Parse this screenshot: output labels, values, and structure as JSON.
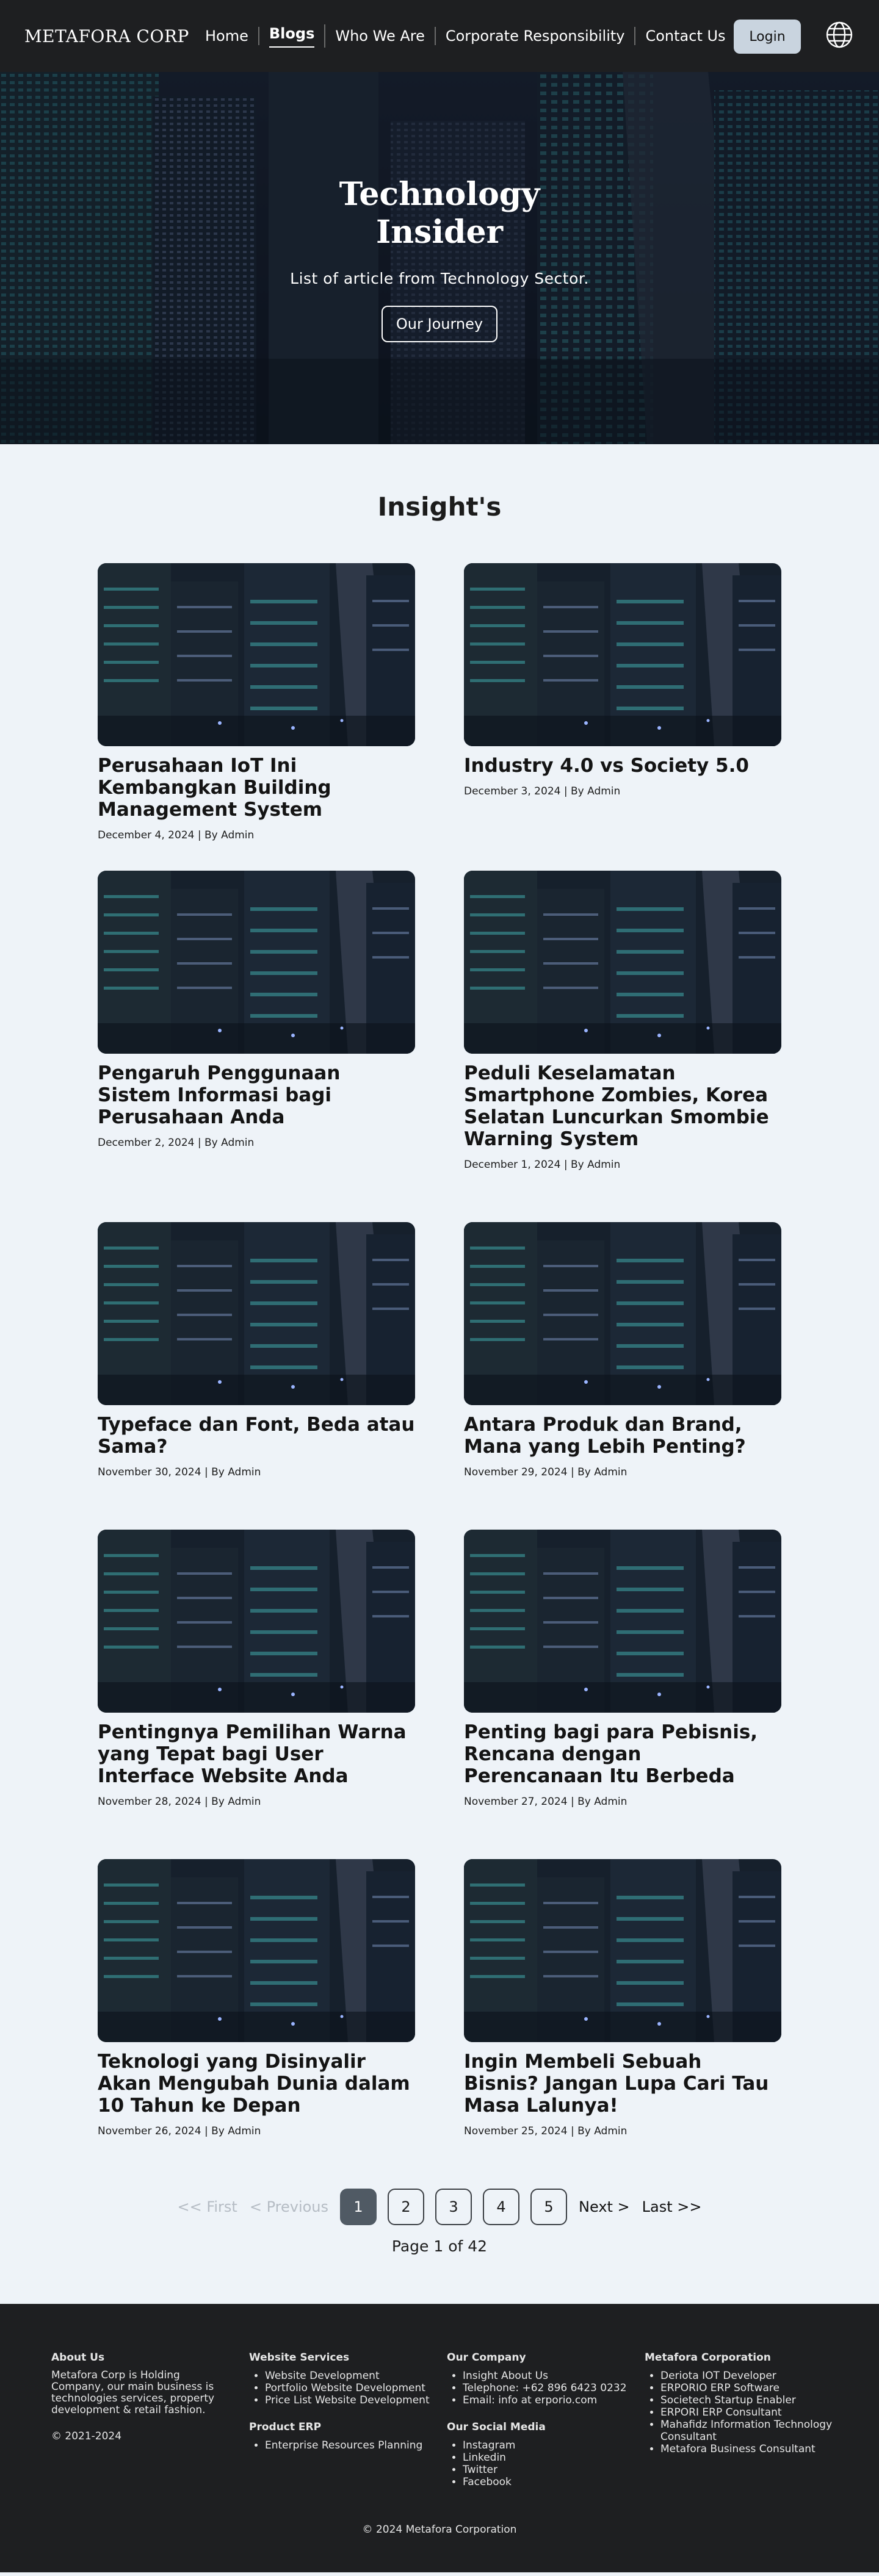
{
  "nav": {
    "brand": "METAFORA CORP",
    "items": [
      {
        "label": "Home"
      },
      {
        "label": "Blogs"
      },
      {
        "label": "Who We Are"
      },
      {
        "label": "Corporate Responsibility"
      },
      {
        "label": "Contact Us"
      }
    ],
    "active": "Blogs",
    "login_label": "Login",
    "language_icon": "globe-icon"
  },
  "hero": {
    "title": "Technology\nInsider",
    "subtitle": "List of article from Technology Sector.",
    "button_label": "Our Journey"
  },
  "insights": {
    "title": "Insight's",
    "posts": [
      {
        "title": "Perusahaan IoT Ini Kembangkan Building Management System",
        "meta": "December 4, 2024 | By Admin"
      },
      {
        "title": "Industry 4.0 vs Society 5.0",
        "meta": "December 3, 2024 | By Admin"
      },
      {
        "title": "Pengaruh Penggunaan Sistem Informasi bagi Perusahaan Anda",
        "meta": "December 2, 2024 | By Admin"
      },
      {
        "title": "Peduli Keselamatan Smartphone Zombies, Korea Selatan Luncurkan Smombie Warning System",
        "meta": "December 1, 2024 | By Admin"
      },
      {
        "title": "Typeface dan Font, Beda atau Sama?",
        "meta": "November 30, 2024 | By Admin"
      },
      {
        "title": "Antara Produk dan Brand, Mana yang Lebih Penting?",
        "meta": "November 29, 2024 | By Admin"
      },
      {
        "title": "Pentingnya Pemilihan Warna yang Tepat bagi User Interface Website Anda",
        "meta": "November 28, 2024 | By Admin"
      },
      {
        "title": "Penting bagi para Pebisnis, Rencana dengan Perencanaan Itu Berbeda",
        "meta": "November 27, 2024 | By Admin"
      },
      {
        "title": "Teknologi yang Disinyalir Akan Mengubah Dunia dalam 10 Tahun ke Depan",
        "meta": "November 26, 2024 | By Admin"
      },
      {
        "title": "Ingin Membeli Sebuah Bisnis? Jangan Lupa Cari Tau Masa Lalunya!",
        "meta": "November 25, 2024 | By Admin"
      }
    ]
  },
  "pagination": {
    "first": "<< First",
    "previous": "< Previous",
    "pages": [
      "1",
      "2",
      "3",
      "4",
      "5"
    ],
    "current": "1",
    "next": "Next >",
    "last": "Last >>",
    "info": "Page 1 of 42"
  },
  "footer": {
    "about": {
      "heading": "About Us",
      "text": "Metafora Corp is Holding Company, our main business is technologies services, property development & retail fashion.",
      "copyright": "© 2021-2024"
    },
    "services": {
      "heading": "Website Services",
      "items": [
        "Website Development",
        "Portfolio Website Development",
        "Price List Website Development"
      ]
    },
    "erp": {
      "heading": "Product ERP",
      "items": [
        "Enterprise Resources Planning"
      ]
    },
    "company": {
      "heading": "Our Company",
      "items": [
        "Insight About Us",
        "Telephone: +62 896 6423 0232",
        "Email: info at erporio.com"
      ]
    },
    "social": {
      "heading": "Our Social Media",
      "items": [
        "Instagram",
        "Linkedin",
        "Twitter",
        "Facebook"
      ]
    },
    "corporation": {
      "heading": "Metafora Corporation",
      "items": [
        "Deriota IOT Developer",
        "ERPORIO ERP Software",
        "Societech Startup Enabler",
        "ERPORI ERP Consultant",
        "Mahafidz Information Technology Consultant",
        "Metafora Business Consultant"
      ]
    },
    "bottom": "© 2024 Metafora Corporation"
  },
  "colors": {
    "nav_bg": "#1e1f21",
    "page_bg": "#eef3f8",
    "login_bg": "#c9d4df",
    "current_page_bg": "#505a64"
  }
}
